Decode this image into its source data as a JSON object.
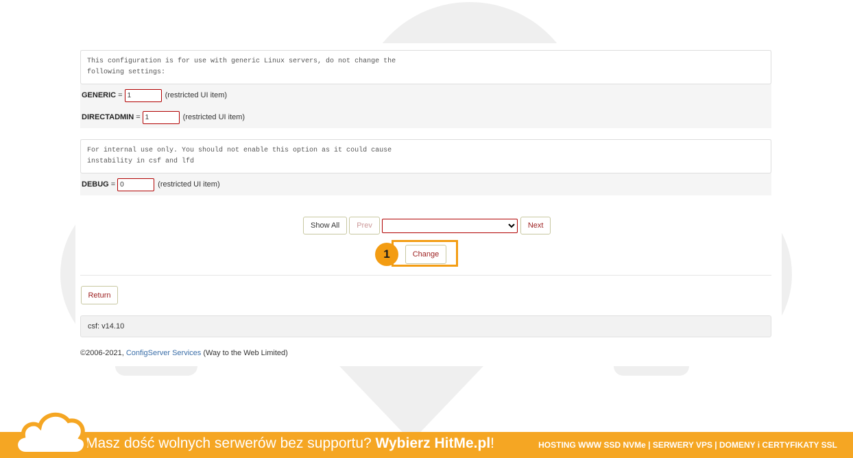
{
  "sections": [
    {
      "comment": "This configuration is for use with generic Linux servers, do not change the\nfollowing settings:",
      "fields": [
        {
          "name": "GENERIC",
          "value": "1",
          "note": "(restricted UI item)"
        },
        {
          "name": "DIRECTADMIN",
          "value": "1",
          "note": "(restricted UI item)"
        }
      ]
    },
    {
      "comment": "For internal use only. You should not enable this option as it could cause\ninstability in csf and lfd",
      "fields": [
        {
          "name": "DEBUG",
          "value": "0",
          "note": "(restricted UI item)"
        }
      ]
    }
  ],
  "nav": {
    "show_all": "Show All",
    "prev": "Prev",
    "select_value": "",
    "next": "Next",
    "change": "Change"
  },
  "annotation": {
    "badge": "1",
    "color": "#f39c12"
  },
  "return_label": "Return",
  "version": "csf: v14.10",
  "footer": {
    "prefix": "©2006-2021, ",
    "link": "ConfigServer Services",
    "suffix": " (Way to the Web Limited)"
  },
  "banner": {
    "text_plain": "Masz dość wolnych serwerów bez supportu? ",
    "text_bold": "Wybierz HitMe.pl",
    "text_end": "!",
    "right": "HOSTING WWW SSD NVMe | SERWERY VPS | DOMENY i CERTYFIKATY SSL",
    "color": "#f5a623"
  }
}
